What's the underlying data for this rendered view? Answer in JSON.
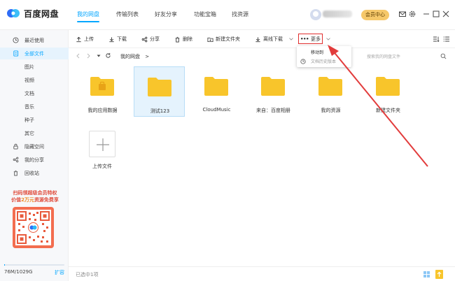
{
  "app": {
    "name": "百度网盘"
  },
  "nav_tabs": [
    {
      "label": "我的网盘"
    },
    {
      "label": "传输列表"
    },
    {
      "label": "好友分享"
    },
    {
      "label": "功能宝箱"
    },
    {
      "label": "找资源"
    }
  ],
  "header": {
    "vip_label": "会员中心"
  },
  "sidebar": {
    "items": [
      {
        "label": "最近使用",
        "icon": "clock-icon"
      },
      {
        "label": "全部文件",
        "icon": "file-icon"
      },
      {
        "label": "图片"
      },
      {
        "label": "视频"
      },
      {
        "label": "文档"
      },
      {
        "label": "音乐"
      },
      {
        "label": "种子"
      },
      {
        "label": "其它"
      },
      {
        "label": "隐藏空间",
        "icon": "lock-icon"
      },
      {
        "label": "我的分享",
        "icon": "share-icon"
      },
      {
        "label": "回收站",
        "icon": "trash-icon"
      }
    ],
    "promo_line1": "扫码领超级会员特权",
    "promo_line2a": "价值",
    "promo_line2b": "2万元",
    "promo_line2c": "资源免费享",
    "storage_text": "76M/1029G",
    "storage_fraction": 0.0001,
    "expand_label": "扩容"
  },
  "toolbar": {
    "upload": "上传",
    "download": "下载",
    "share": "分享",
    "delete": "删除",
    "new_folder": "新建文件夹",
    "offline_download": "离线下载",
    "more": "更多"
  },
  "dropdown": {
    "items": [
      {
        "label": "移动到"
      },
      {
        "label": "文档历史版本"
      }
    ]
  },
  "path": {
    "crumb": "我的网盘",
    "separator": ">",
    "search_placeholder": "搜索我的网盘文件"
  },
  "files": [
    {
      "name": "我的应用数据",
      "type": "app-folder"
    },
    {
      "name": "测试123",
      "type": "folder",
      "selected": true
    },
    {
      "name": "CloudMusic",
      "type": "folder"
    },
    {
      "name": "来自：百度相册",
      "type": "folder"
    },
    {
      "name": "我的资源",
      "type": "folder"
    },
    {
      "name": "新建文件夹",
      "type": "folder"
    }
  ],
  "upload_tile": {
    "label": "上传文件"
  },
  "status": {
    "text": "已选中1项"
  },
  "colors": {
    "accent": "#06a7ff",
    "folder": "#f8c52b",
    "highlight": "#e02e2e"
  }
}
